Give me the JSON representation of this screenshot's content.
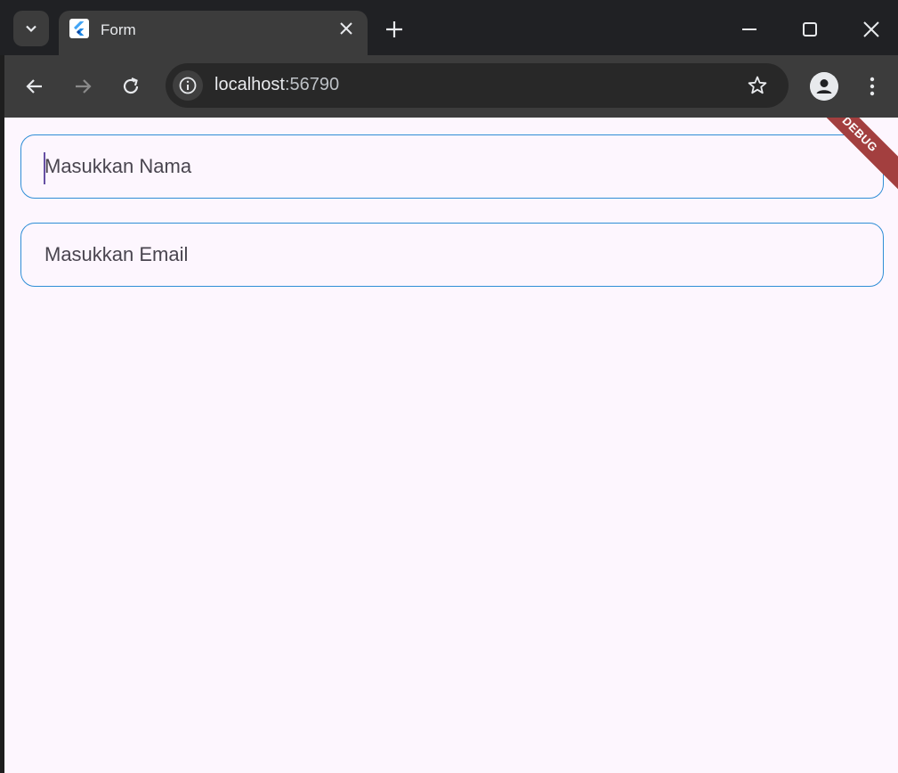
{
  "browser": {
    "tab": {
      "title": "Form"
    },
    "address": {
      "host": "localhost",
      "port": ":56790"
    }
  },
  "page": {
    "fields": [
      {
        "placeholder": "Masukkan Nama"
      },
      {
        "placeholder": "Masukkan Email"
      }
    ],
    "debug_banner": "DEBUG"
  },
  "colors": {
    "field_border": "#2f8ed6",
    "page_background": "#fdf6fe",
    "caret": "#6750a4",
    "debug_banner": "#a33f3f"
  }
}
